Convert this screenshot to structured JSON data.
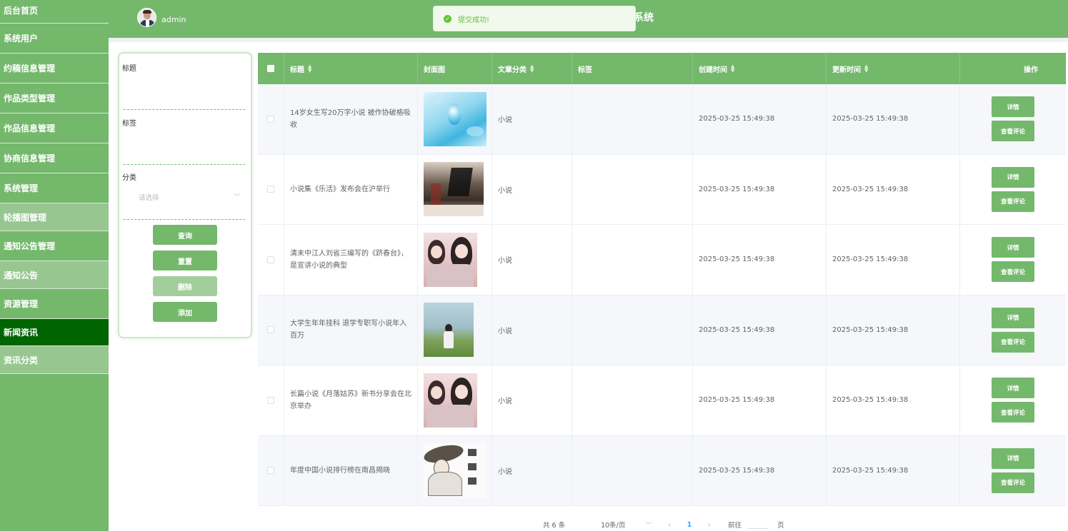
{
  "sidebar": {
    "items": [
      {
        "label": "后台首页"
      },
      {
        "label": "系统用户"
      },
      {
        "label": "约稿信息管理"
      },
      {
        "label": "作品类型管理"
      },
      {
        "label": "作品信息管理"
      },
      {
        "label": "协商信息管理"
      },
      {
        "label": "系统管理"
      },
      {
        "label": "轮播图管理"
      },
      {
        "label": "通知公告管理"
      },
      {
        "label": "通知公告"
      },
      {
        "label": "资源管理"
      },
      {
        "label": "新闻资讯"
      },
      {
        "label": "资讯分类"
      }
    ]
  },
  "header": {
    "username": "admin",
    "title_fragment": "系统"
  },
  "toast": {
    "message": "提交成功!"
  },
  "search": {
    "title_label": "标题",
    "tag_label": "标签",
    "category_label": "分类",
    "category_placeholder": "请选择",
    "query_button": "查询",
    "reset_button": "重置",
    "delete_button": "删除",
    "add_button": "添加"
  },
  "table": {
    "columns": [
      "标题",
      "封面图",
      "文章分类",
      "标签",
      "创建时间",
      "更新时间",
      "操作"
    ],
    "detail_label": "详情",
    "comments_label": "查看评论",
    "rows": [
      {
        "title": "14岁女生写20万字小说 被作协破格吸收",
        "category": "小说",
        "tags": "",
        "created": "2025-03-25 15:49:38",
        "updated": "2025-03-25 15:49:38"
      },
      {
        "title": "小说集《乐活》发布会在沪举行",
        "category": "小说",
        "tags": "",
        "created": "2025-03-25 15:49:38",
        "updated": "2025-03-25 15:49:38"
      },
      {
        "title": "清末中江人刘省三编写的《跻春台》，是宣讲小说的典型",
        "category": "小说",
        "tags": "",
        "created": "2025-03-25 15:49:38",
        "updated": "2025-03-25 15:49:38"
      },
      {
        "title": "大学生年年挂科 退学专职写小说年入百万",
        "category": "小说",
        "tags": "",
        "created": "2025-03-25 15:49:38",
        "updated": "2025-03-25 15:49:38"
      },
      {
        "title": "长篇小说《月落姑苏》新书分享会在北京举办",
        "category": "小说",
        "tags": "",
        "created": "2025-03-25 15:49:38",
        "updated": "2025-03-25 15:49:38"
      },
      {
        "title": "年度中国小说排行榜在南昌揭晓",
        "category": "小说",
        "tags": "",
        "created": "2025-03-25 15:49:38",
        "updated": "2025-03-25 15:49:38"
      }
    ]
  },
  "pagination": {
    "total": "共 6 条",
    "page_size": "10条/页",
    "prev": "‹",
    "current": "1",
    "next": "›",
    "goto_label": "前往",
    "page_suffix": "页"
  },
  "colors": {
    "primary": "#74b86c",
    "active_menu": "#006400",
    "success": "#67c23a"
  }
}
